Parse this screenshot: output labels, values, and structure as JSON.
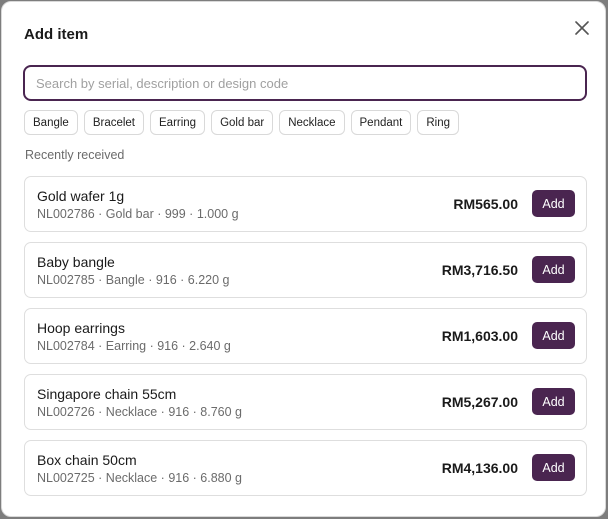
{
  "dialog": {
    "title": "Add item",
    "search_placeholder": "Search by serial, description or design code",
    "search_value": "",
    "categories": [
      "Bangle",
      "Bracelet",
      "Earring",
      "Gold bar",
      "Necklace",
      "Pendant",
      "Ring"
    ],
    "section_label": "Recently received",
    "add_label": "Add",
    "items": [
      {
        "name": "Gold wafer 1g",
        "meta": "NL002786 · Gold bar · 999 · 1.000 g",
        "price": "RM565.00"
      },
      {
        "name": "Baby bangle",
        "meta": "NL002785 · Bangle · 916 · 6.220 g",
        "price": "RM3,716.50"
      },
      {
        "name": "Hoop earrings",
        "meta": "NL002784 · Earring · 916 · 2.640 g",
        "price": "RM1,603.00"
      },
      {
        "name": "Singapore chain 55cm",
        "meta": "NL002726 · Necklace · 916 · 8.760 g",
        "price": "RM5,267.00"
      },
      {
        "name": "Box chain 50cm",
        "meta": "NL002725 · Necklace · 916 · 6.880 g",
        "price": "RM4,136.00"
      }
    ]
  },
  "colors": {
    "accent": "#4a2550",
    "muted_text": "#6b6b6b",
    "border": "#dedede"
  },
  "icons": {
    "close": "close-icon"
  }
}
